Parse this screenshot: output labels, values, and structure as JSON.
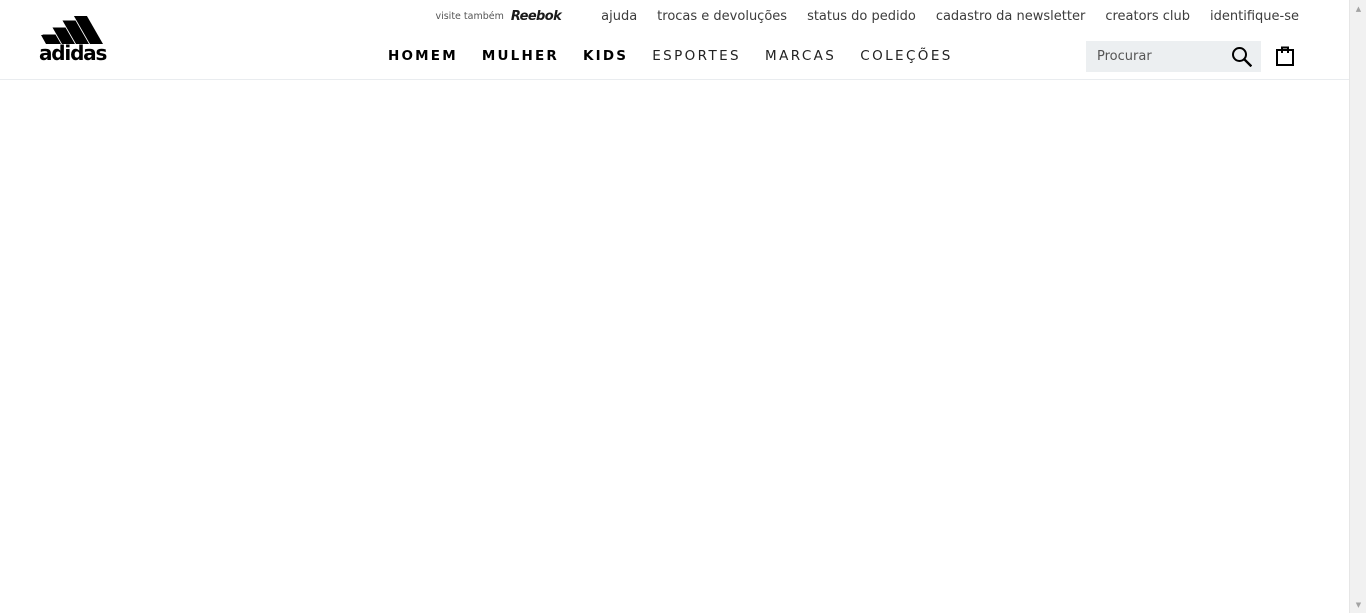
{
  "brand": {
    "logo_text": "adidas",
    "visit_label": "visite também",
    "partner_brand": "Reebok"
  },
  "utility_links": [
    "ajuda",
    "trocas e devoluções",
    "status do pedido",
    "cadastro da newsletter",
    "creators club",
    "identifique-se"
  ],
  "main_nav": [
    {
      "label": "HOMEM",
      "weight": "bold"
    },
    {
      "label": "MULHER",
      "weight": "bold"
    },
    {
      "label": "KIDS",
      "weight": "bold"
    },
    {
      "label": "ESPORTES",
      "weight": "normal"
    },
    {
      "label": "MARCAS",
      "weight": "normal"
    },
    {
      "label": "COLEÇÕES",
      "weight": "normal"
    }
  ],
  "search": {
    "placeholder": "Procurar",
    "value": ""
  },
  "icons": {
    "search": "search-icon",
    "bag": "shopping-bag-icon",
    "logo": "adidas-performance-logo-icon"
  },
  "colors": {
    "text": "#000000",
    "search_bg": "#eceff1",
    "header_border": "#e9ecef"
  }
}
